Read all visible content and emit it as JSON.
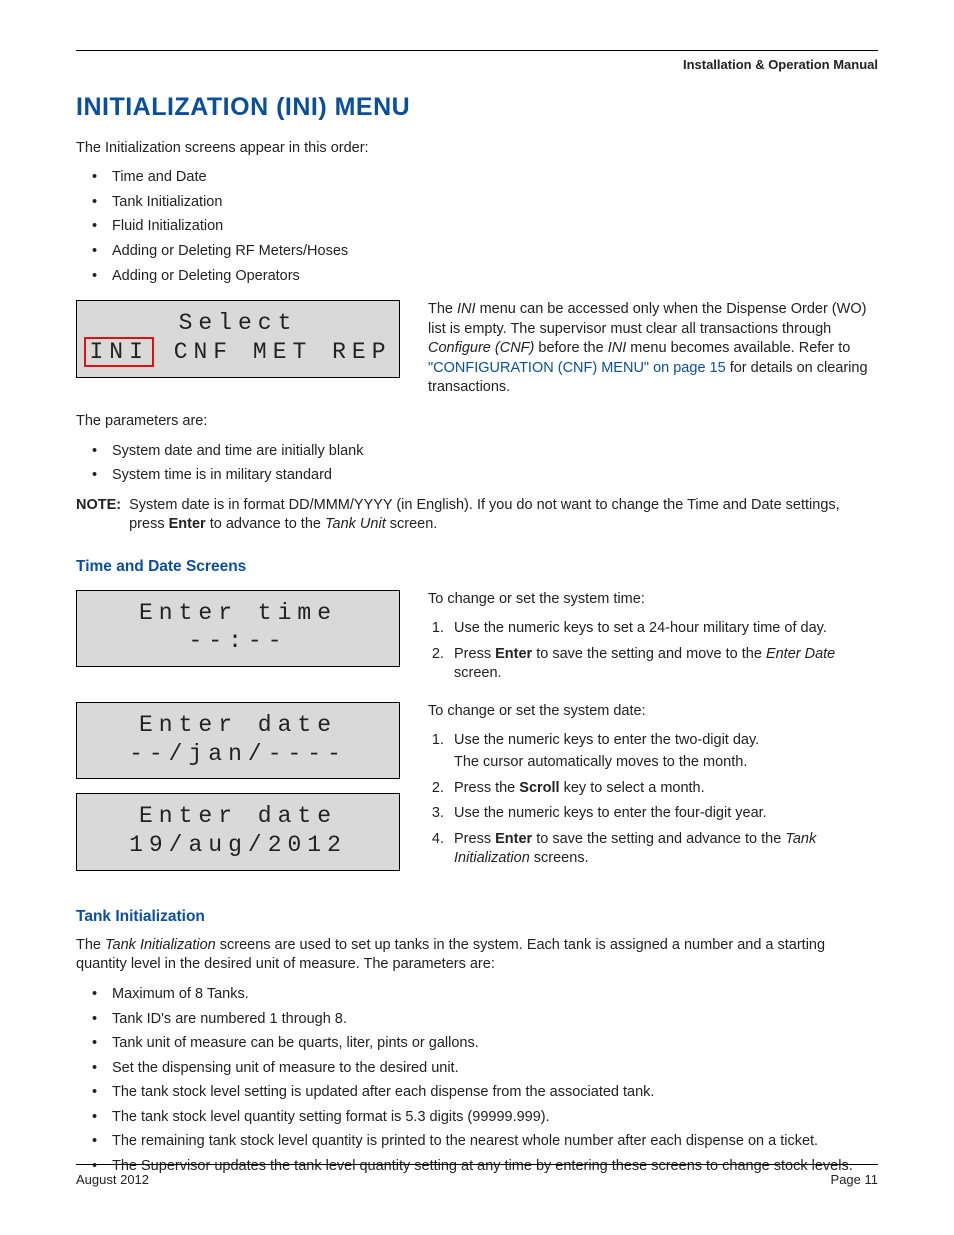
{
  "running_head": "Installation & Operation Manual",
  "h1": "INITIALIZATION (INI) MENU",
  "intro": "The Initialization screens appear in this order:",
  "intro_bullets": [
    "Time and Date",
    "Tank Initialization",
    "Fluid Initialization",
    "Adding or Deleting RF Meters/Hoses",
    "Adding or Deleting Operators"
  ],
  "lcd_select": {
    "line1": "Select",
    "sel": "INI",
    "rest": " CNF MET REP"
  },
  "ini_para": {
    "pre": "The ",
    "i1": "INI",
    "mid1": " menu can be accessed only when the Dispense Order (WO) list is empty. The supervisor must clear all transactions through ",
    "i2": "Configure (CNF)",
    "mid2": " before the ",
    "i3": "INI",
    "mid3": " menu becomes available. Refer to ",
    "link": "\"CONFIGURATION (CNF) MENU\" on page 15",
    "post": " for details on clearing transactions."
  },
  "params_intro": "The parameters are:",
  "params_bullets": [
    "System date and time are initially blank",
    "System time is in military standard"
  ],
  "note": {
    "label": "NOTE:",
    "text_pre": "System date is in format DD/MMM/YYYY (in English). If you do not want to change the Time and Date settings, press ",
    "b1": "Enter",
    "text_mid": " to advance to the ",
    "i1": "Tank Unit",
    "text_post": " screen."
  },
  "h2_time": "Time and Date Screens",
  "lcd_time": {
    "line1": "Enter time",
    "line2": "--:--"
  },
  "time_intro": "To change or set the system time:",
  "time_steps": {
    "s1": "Use the numeric keys to set a 24-hour military time of day.",
    "s2_pre": "Press ",
    "s2_b": "Enter",
    "s2_mid": " to save the setting and move to the ",
    "s2_i": "Enter Date",
    "s2_post": " screen."
  },
  "lcd_date1": {
    "line1": "Enter date",
    "line2": "--/jan/----"
  },
  "lcd_date2": {
    "line1": "Enter date",
    "line2": "19/aug/2012"
  },
  "date_intro": "To change or set the system date:",
  "date_steps": {
    "s1a": "Use the numeric keys to enter the two-digit day.",
    "s1b": "The cursor automatically moves to the month.",
    "s2_pre": "Press the ",
    "s2_b": "Scroll",
    "s2_post": " key to select a month.",
    "s3": "Use the numeric keys to enter the four-digit year.",
    "s4_pre": "Press ",
    "s4_b": "Enter",
    "s4_mid": " to save the setting and advance to the ",
    "s4_i": "Tank Initialization",
    "s4_post": " screens."
  },
  "h2_tank": "Tank Initialization",
  "tank_para": {
    "pre": "The ",
    "i1": "Tank Initialization",
    "post": " screens are used to set up tanks in the system. Each tank is assigned a number and a starting quantity level in the desired unit of measure. The parameters are:"
  },
  "tank_bullets": [
    "Maximum of 8 Tanks.",
    "Tank ID's are numbered 1 through 8.",
    "Tank unit of measure can be quarts, liter, pints or gallons.",
    "Set the dispensing unit of measure to the desired unit.",
    "The tank stock level setting is updated after each dispense from the associated tank.",
    "The tank stock level quantity setting format is 5.3 digits (99999.999).",
    "The remaining tank stock level quantity is printed to the nearest whole number after each dispense on a ticket.",
    "The Supervisor updates the tank level quantity setting at any time by entering these screens to change stock levels."
  ],
  "footer": {
    "left": "August 2012",
    "right": "Page 11"
  }
}
